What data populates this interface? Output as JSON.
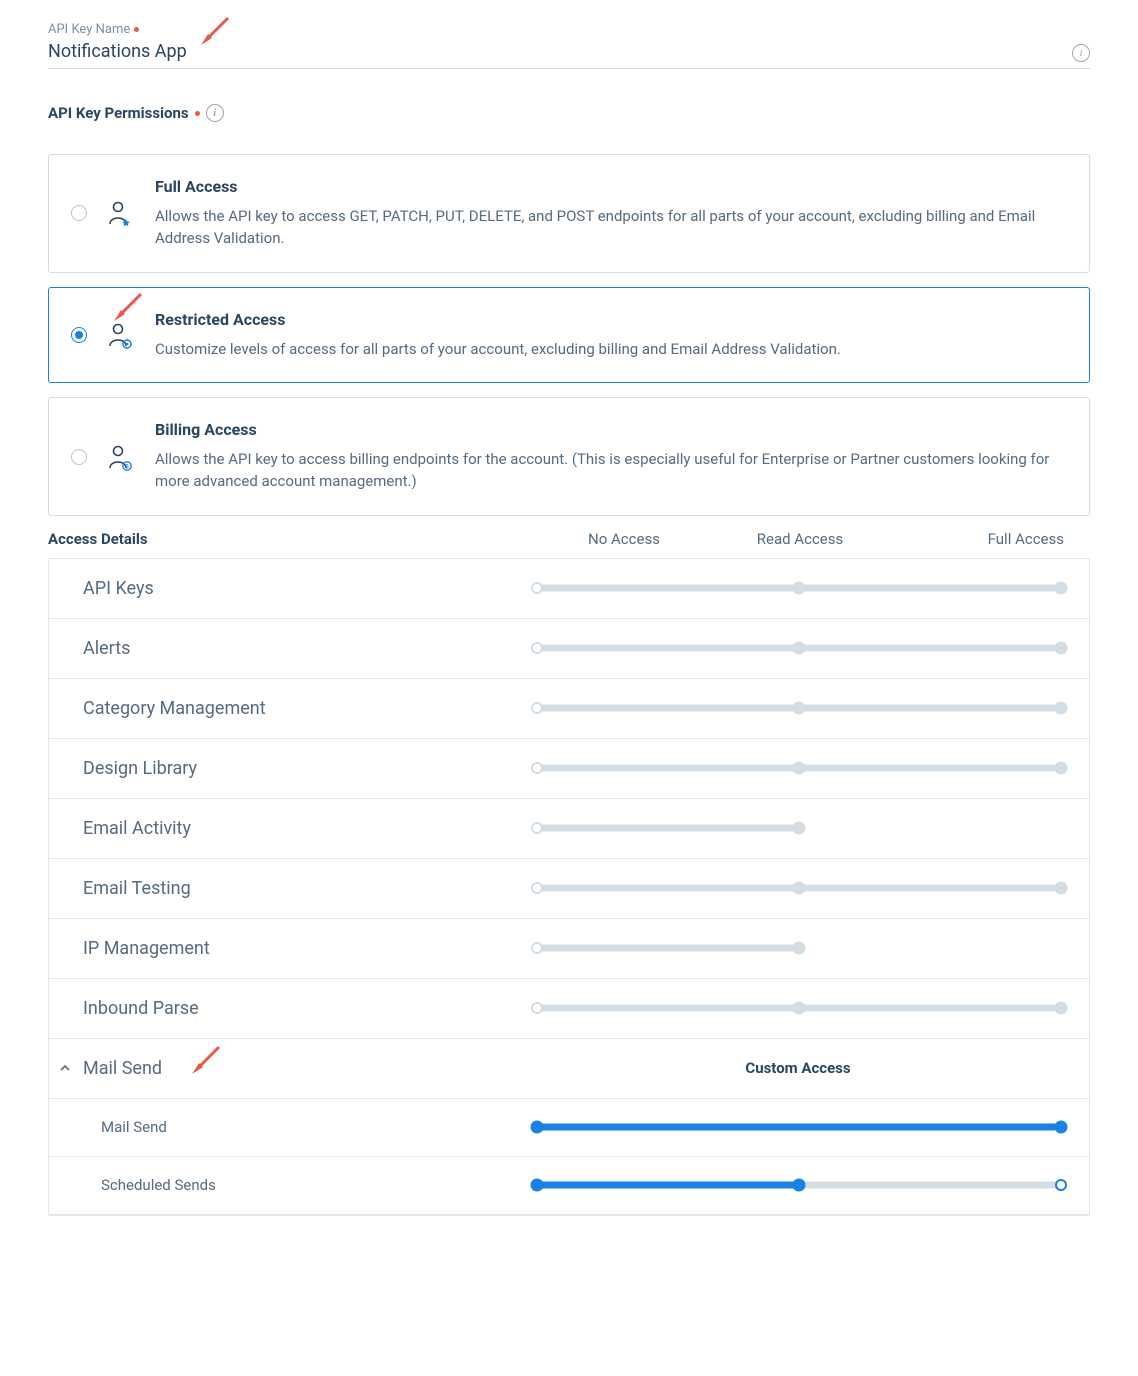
{
  "fieldLabel": "API Key Name",
  "fieldValue": "Notifications App",
  "sectionTitle": "API Key Permissions",
  "permissions": [
    {
      "key": "full",
      "title": "Full Access",
      "desc": "Allows the API key to access GET, PATCH, PUT, DELETE, and POST endpoints for all parts of your account, excluding billing and Email Address Validation.",
      "selected": false,
      "badge": "star"
    },
    {
      "key": "restricted",
      "title": "Restricted Access",
      "desc": "Customize levels of access for all parts of your account, excluding billing and Email Address Validation.",
      "selected": true,
      "badge": "gear"
    },
    {
      "key": "billing",
      "title": "Billing Access",
      "desc": "Allows the API key to access billing endpoints for the account. (This is especially useful for Enterprise or Partner customers looking for more advanced account management.)",
      "selected": false,
      "badge": "dollar"
    }
  ],
  "accessDetailsLabel": "Access Details",
  "headers": {
    "none": "No Access",
    "read": "Read Access",
    "full": "Full Access"
  },
  "rows": [
    {
      "label": "API Keys",
      "stops": 3,
      "value": 0
    },
    {
      "label": "Alerts",
      "stops": 3,
      "value": 0
    },
    {
      "label": "Category Management",
      "stops": 3,
      "value": 0
    },
    {
      "label": "Design Library",
      "stops": 3,
      "value": 0
    },
    {
      "label": "Email Activity",
      "stops": 2,
      "value": 0
    },
    {
      "label": "Email Testing",
      "stops": 3,
      "value": 0
    },
    {
      "label": "IP Management",
      "stops": 2,
      "value": 0
    },
    {
      "label": "Inbound Parse",
      "stops": 3,
      "value": 0
    }
  ],
  "expand": {
    "label": "Mail Send",
    "customLabel": "Custom Access",
    "children": [
      {
        "label": "Mail Send",
        "stops": 2,
        "value": 1,
        "twoStopFull": true
      },
      {
        "label": "Scheduled Sends",
        "stops": 3,
        "value": 1
      }
    ]
  }
}
